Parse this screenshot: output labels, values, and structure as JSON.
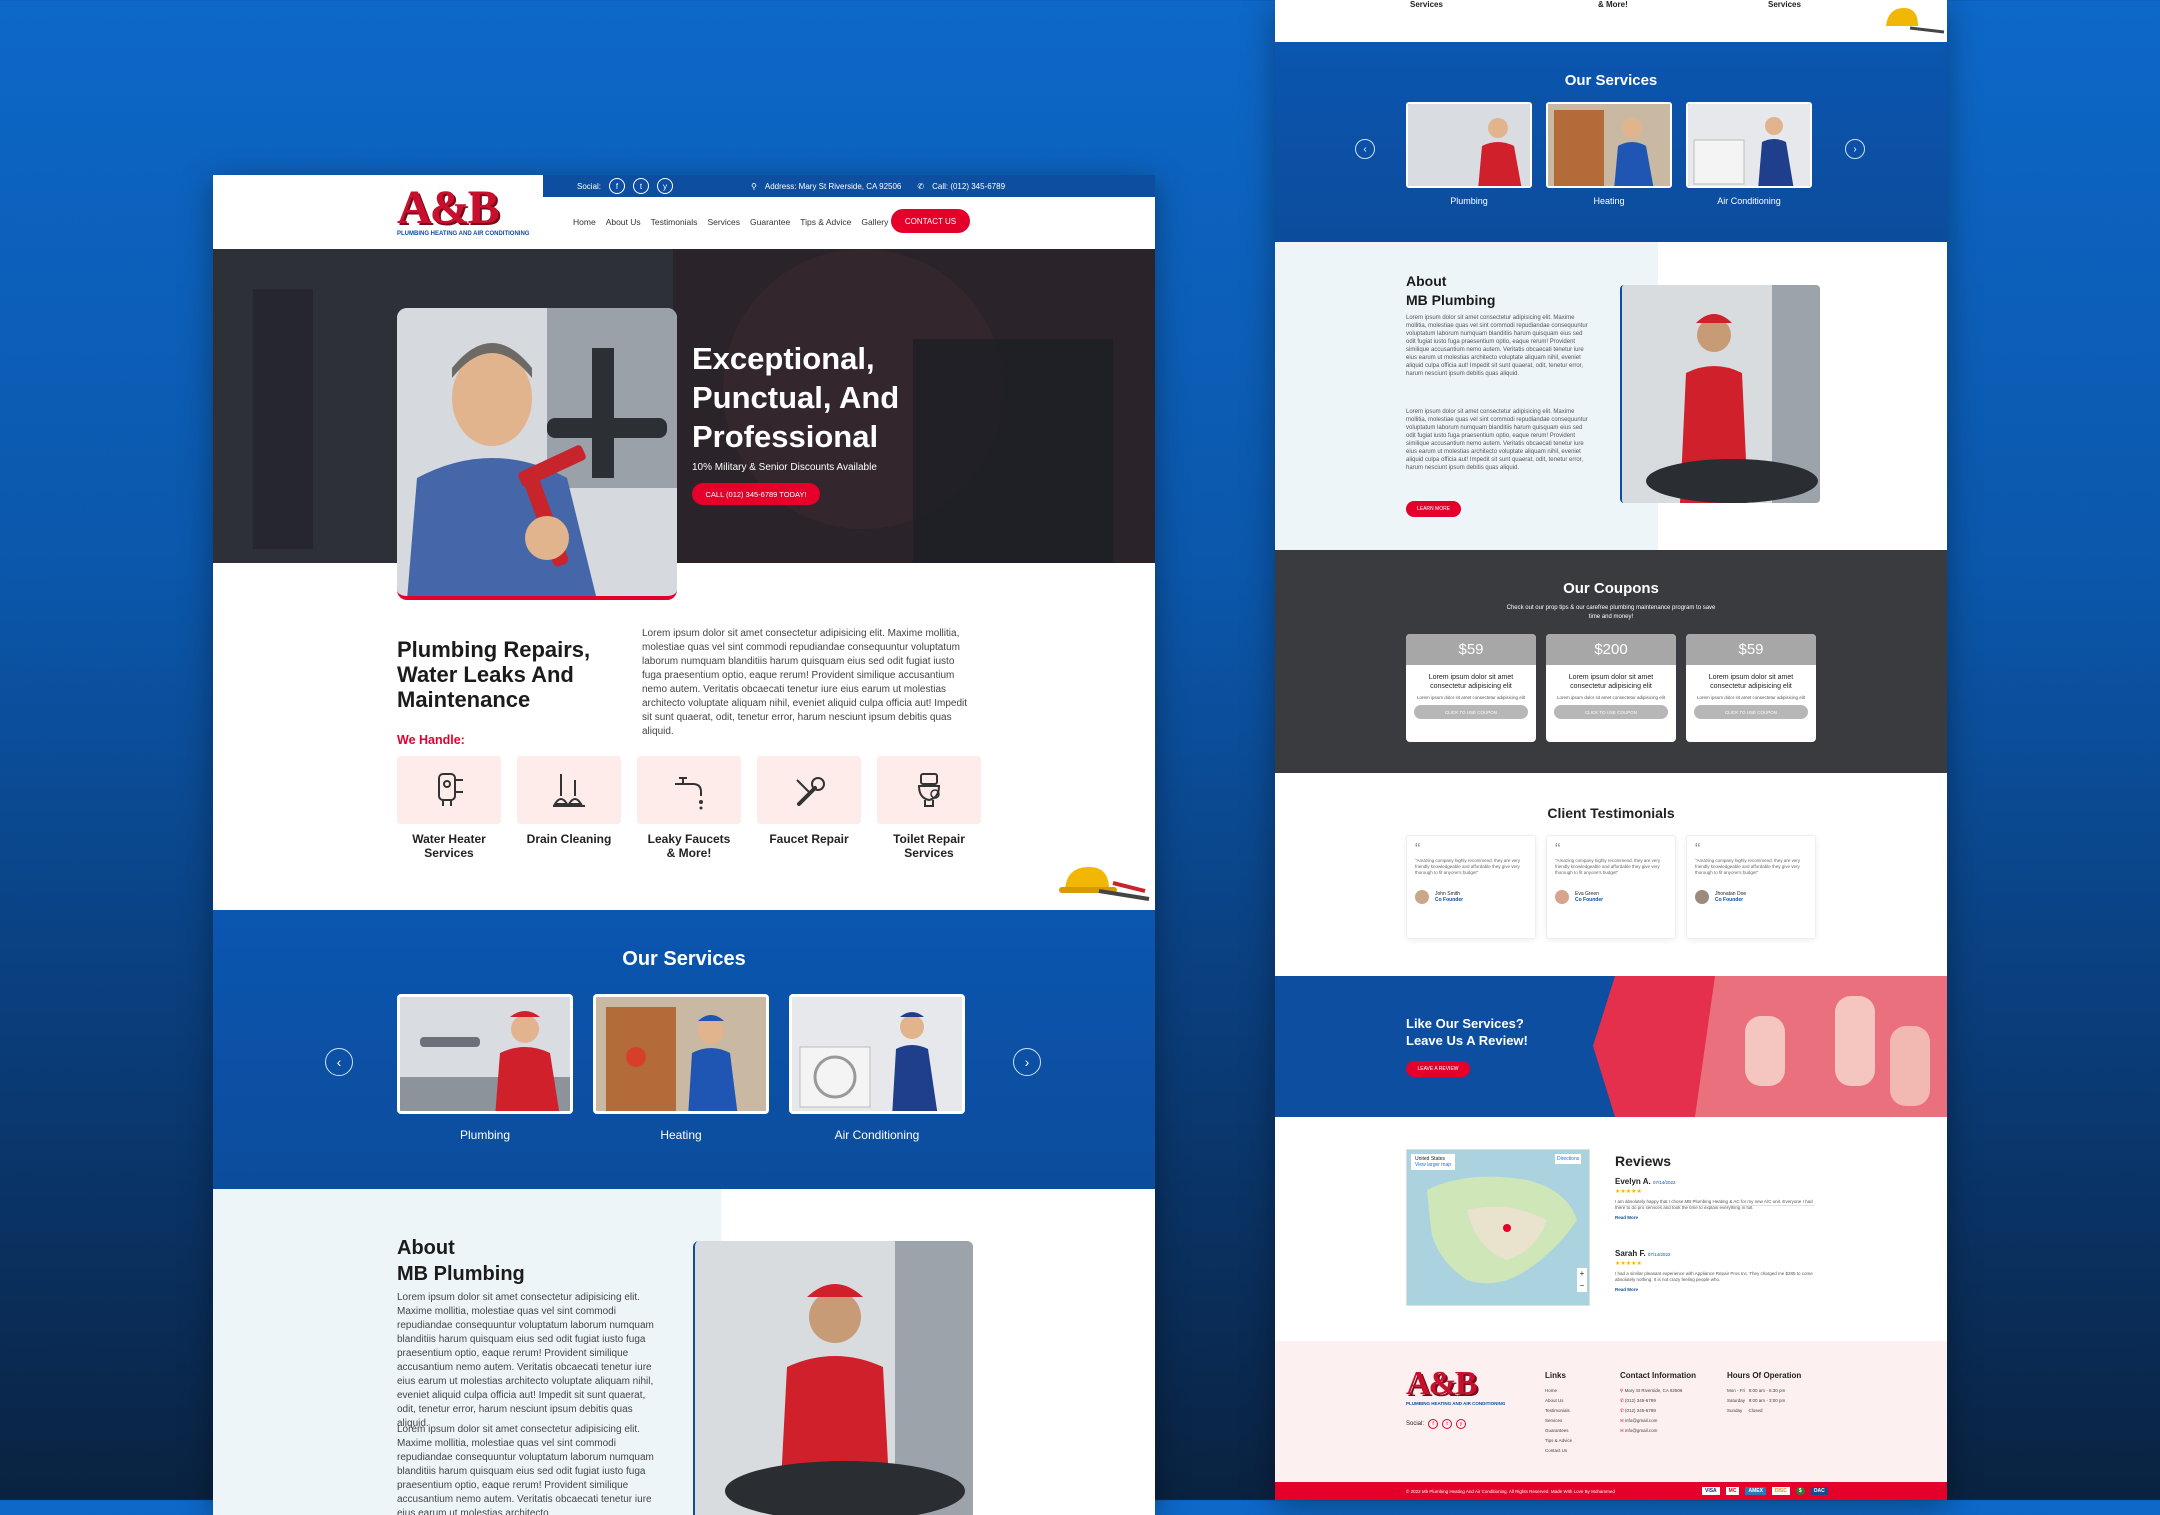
{
  "left": {
    "topbar": {
      "social_label": "Social:",
      "address": "Address: Mary St Riverside, CA 92506",
      "phone": "Call: (012) 345-6789"
    },
    "logo": {
      "mark": "A&B",
      "tagline": "PLUMBING HEATING AND AIR CONDITIONING"
    },
    "nav": [
      "Home",
      "About Us",
      "Testimonials",
      "Services",
      "Guarantee",
      "Tips & Advice",
      "Gallery"
    ],
    "contact_button": "CONTACT US",
    "hero": {
      "line1": "Exceptional,",
      "line2": "Punctual, And",
      "line3": "Professional",
      "sub": "10% Military & Senior Discounts Available",
      "cta": "CALL (012) 345-6789 TODAY!"
    },
    "intro": {
      "title1": "Plumbing Repairs,",
      "title2": "Water Leaks And",
      "title3": "Maintenance",
      "body": "Lorem ipsum dolor sit amet consectetur adipisicing elit. Maxime mollitia, molestiae quas vel sint commodi repudiandae consequuntur voluptatum laborum numquam blanditiis harum quisquam eius sed odit fugiat iusto fuga praesentium optio, eaque rerum! Provident similique accusantium nemo autem. Veritatis obcaecati tenetur iure eius earum ut molestias architecto voluptate aliquam nihil, eveniet aliquid culpa officia aut! Impedit sit sunt quaerat, odit, tenetur error, harum nesciunt ipsum debitis quas aliquid."
    },
    "we_handle": "We Handle:",
    "handles": [
      {
        "l1": "Water Heater",
        "l2": "Services"
      },
      {
        "l1": "Drain Cleaning",
        "l2": ""
      },
      {
        "l1": "Leaky Faucets",
        "l2": "& More!"
      },
      {
        "l1": "Faucet Repair",
        "l2": ""
      },
      {
        "l1": "Toilet Repair",
        "l2": "Services"
      }
    ],
    "services_title": "Our Services",
    "services": [
      "Plumbing",
      "Heating",
      "Air Conditioning"
    ],
    "about": {
      "t1": "About",
      "t2": "MB Plumbing",
      "p1": "Lorem ipsum dolor sit amet consectetur adipisicing elit. Maxime mollitia, molestiae quas vel sint commodi repudiandae consequuntur voluptatum laborum numquam blanditiis harum quisquam eius sed odit fugiat iusto fuga praesentium optio, eaque rerum! Provident similique accusantium nemo autem. Veritatis obcaecati tenetur iure eius earum ut molestias architecto voluptate aliquam nihil, eveniet aliquid culpa officia aut! Impedit sit sunt quaerat, odit, tenetur error, harum nesciunt ipsum debitis quas aliquid.",
      "p2": "Lorem ipsum dolor sit amet consectetur adipisicing elit. Maxime mollitia, molestiae quas vel sint commodi repudiandae consequuntur voluptatum laborum numquam blanditiis harum quisquam eius sed odit fugiat iusto fuga praesentium optio, eaque rerum! Provident similique accusantium nemo autem. Veritatis obcaecati tenetur iure eius earum ut molestias architecto"
    }
  },
  "right": {
    "top_labels": [
      "Services",
      "& More!",
      "Services"
    ],
    "services_title": "Our Services",
    "services": [
      "Plumbing",
      "Heating",
      "Air Conditioning"
    ],
    "about": {
      "t1": "About",
      "t2": "MB Plumbing",
      "p1": "Lorem ipsum dolor sit amet consectetur adipisicing elit. Maxime mollitia, molestiae quas vel sint commodi repudiandae consequuntur voluptatum laborum numquam blanditiis harum quisquam eius sed odit fugiat iusto fuga praesentium optio, eaque rerum! Provident similique accusantium nemo autem. Veritatis obcaecati tenetur iure eius earum ut molestias architecto voluptate aliquam nihil, eveniet aliquid culpa officia aut! Impedit sit sunt quaerat, odit, tenetur error, harum nesciunt ipsum debitis quas aliquid.",
      "p2": "Lorem ipsum dolor sit amet consectetur adipisicing elit. Maxime mollitia, molestiae quas vel sint commodi repudiandae consequuntur voluptatum laborum numquam blanditiis harum quisquam eius sed odit fugiat iusto fuga praesentium optio, eaque rerum! Provident similique accusantium nemo autem. Veritatis obcaecati tenetur iure eius earum ut molestias architecto voluptate aliquam nihil, eveniet aliquid culpa officia aut! Impedit sit sunt quaerat, odit, tenetur error, harum nesciunt ipsum debitis quas aliquid.",
      "cta": "LEARN MORE"
    },
    "coupons": {
      "title": "Our Coupons",
      "sub1": "Check out our prop tips & our carefree plumbing maintenance program to save",
      "sub2": "time and money!",
      "items": [
        {
          "price": "$59",
          "h1": "Lorem ipsum dolor sit amet",
          "h2": "consectetur adipisicing elit",
          "small": "Lorem ipsum dolor sit amet consectetur adipisicing elit",
          "btn": "CLICK TO USE COUPON"
        },
        {
          "price": "$200",
          "h1": "Lorem ipsum dolor sit amet",
          "h2": "consectetur adipisicing elit",
          "small": "Lorem ipsum dolor sit amet consectetur adipisicing elit",
          "btn": "CLICK TO USE COUPON"
        },
        {
          "price": "$59",
          "h1": "Lorem ipsum dolor sit amet",
          "h2": "consectetur adipisicing elit",
          "small": "Lorem ipsum dolor sit amet consectetur adipisicing elit",
          "btn": "CLICK TO USE COUPON"
        }
      ]
    },
    "testimonials": {
      "title": "Client Testimonials",
      "items": [
        {
          "quote": "\"Amazing company highly recommend. they are very friendly knowledgeable and affordable they give very thorough to fit anyone's budget\"",
          "name": "John Smith",
          "role": "Co Founder"
        },
        {
          "quote": "\"Amazing company highly recommend. they are very friendly knowledgeable and affordable they give very thorough to fit anyone's budget\"",
          "name": "Eva Green",
          "role": "Co Founder"
        },
        {
          "quote": "\"Amazing company highly recommend. they are very friendly knowledgeable and affordable they give very thorough to fit anyone's budget\"",
          "name": "Jhonatan Doe",
          "role": "Co Founder"
        }
      ]
    },
    "review_band": {
      "l1": "Like Our Services?",
      "l2": "Leave Us A Review!",
      "btn": "LEAVE A REVIEW"
    },
    "map": {
      "label": "United States",
      "link": "View larger map",
      "dir": "Directions"
    },
    "reviews": {
      "title": "Reviews",
      "items": [
        {
          "name": "Evelyn A.",
          "date": "07/14/2022",
          "stars": "★★★★★",
          "text": "I am absolutely happy that I chose MB Plumbing Heating & AC for my new A/C unit. Everyone I had there to do pro services and took the time to explain everything in full.",
          "more": "Read More"
        },
        {
          "name": "Sarah F.",
          "date": "07/14/2022",
          "stars": "★★★★★",
          "text": "I had a similar pleasant experience with Appliance Repair Pros Inc. They charged me $285 to come absolutely nothing. It is not crazy feeling people who.",
          "more": "Read More"
        }
      ]
    },
    "footer": {
      "social": "Social:",
      "links_title": "Links",
      "links": [
        "Home",
        "About Us",
        "Testimonials",
        "Services",
        "Guarantees",
        "Tips & Advice",
        "Contact Us"
      ],
      "contact_title": "Contact Information",
      "contact": [
        "Mary St Riverside, CA 92506",
        "(012) 345-6789",
        "(012) 345-6789",
        "info@gmail.com",
        "info@gmail.com"
      ],
      "hours_title": "Hours Of Operation",
      "hours": [
        [
          "Mon - Fri",
          "8:00 am - 6:30 pm"
        ],
        [
          "Saturday",
          "9:00 am - 3:00 pm"
        ],
        [
          "Sunday",
          "Closed"
        ]
      ],
      "copyright": "© 2022 Mb Plumbing Heating And Air Conditioning. All Rights Reserved. Made With Love By Mohammed",
      "payments": [
        "VISA",
        "MC",
        "AMEX",
        "DISC",
        "$",
        "OAC"
      ]
    }
  },
  "colors": {
    "brand_blue": "#0d4ea0",
    "brand_red": "#e4002b",
    "hero_dark": "#2b2d33",
    "coupon_gray": "#a7a7a7"
  }
}
